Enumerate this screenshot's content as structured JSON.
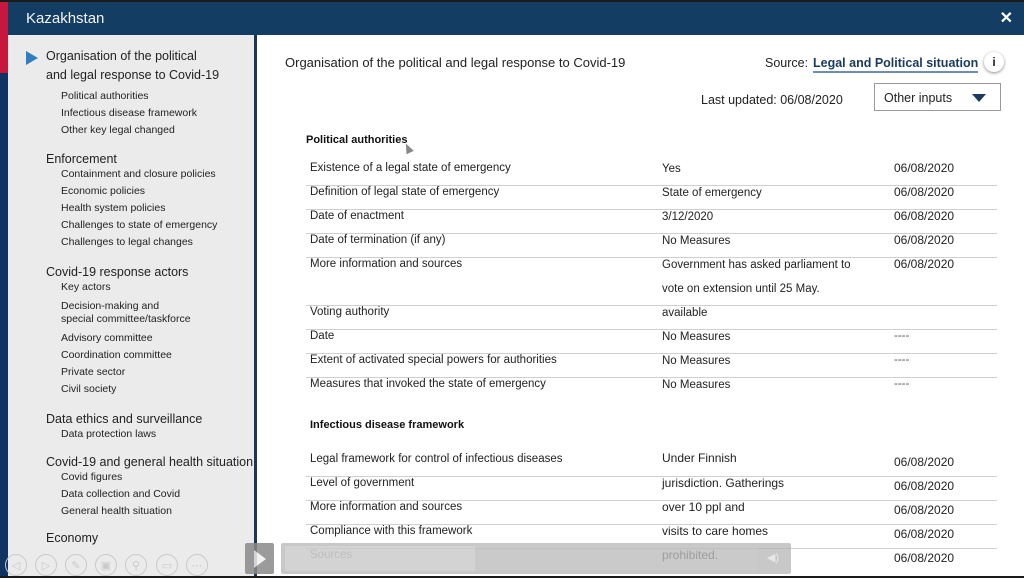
{
  "window": {
    "title": "Kazakhstan",
    "close_icon": "close-icon"
  },
  "sidebar": {
    "active_indicator_icon": "triangle-right-icon",
    "sections": [
      {
        "title_line1": "Organisation of the political",
        "title_line2": "and legal response to Covid-19",
        "items": [
          "Political authorities",
          "Infectious disease framework",
          "Other key legal changed"
        ]
      },
      {
        "title": "Enforcement",
        "items": [
          "Containment and closure policies",
          "Economic policies",
          "Health system policies",
          "Challenges to state of emergency",
          "Challenges to legal changes"
        ]
      },
      {
        "title": "Covid-19 response actors",
        "items": [
          "Key actors",
          "Decision-making and",
          "special committee/taskforce",
          "Advisory committee",
          "Coordination committee",
          "Private sector",
          "Civil society"
        ]
      },
      {
        "title": "Data ethics and surveillance",
        "items": [
          "Data protection laws"
        ]
      },
      {
        "title": "Covid-19 and general health situation",
        "items": [
          "Covid figures",
          "Data collection and Covid",
          "General health situation"
        ]
      },
      {
        "title": "Economy",
        "items": []
      }
    ]
  },
  "player_controls": {
    "icons": [
      "previous-icon",
      "next-icon",
      "pen-icon",
      "slides-icon",
      "zoom-icon",
      "subtitles-icon",
      "more-icon"
    ],
    "play_icon": "play-icon",
    "volume_icon": "volume-icon"
  },
  "main": {
    "title": "Organisation of the political and legal response to Covid-19",
    "source_label": "Source:",
    "source_link": "Legal and Political situation",
    "info_icon": "i",
    "last_updated": "Last updated: 06/08/2020",
    "dropdown": {
      "selected": "Other inputs"
    },
    "sections": [
      {
        "heading": "Political authorities",
        "rows": [
          {
            "field": "Existence of a legal state of emergency",
            "value": "Yes",
            "date": "06/08/2020"
          },
          {
            "field": "Definition of legal state of emergency",
            "value": "State of emergency",
            "date": "06/08/2020"
          },
          {
            "field": "Date of enactment",
            "value": "3/12/2020",
            "date": "06/08/2020"
          },
          {
            "field": "Date of termination (if any)",
            "value": "No Measures",
            "date": "06/08/2020"
          },
          {
            "field": "More information and sources",
            "value_line1": "Government has asked parliament to",
            "value_line2": "vote on extension until 25 May.",
            "date": "06/08/2020"
          },
          {
            "field": "Voting authority",
            "value": "available",
            "date": ""
          },
          {
            "field": "Date",
            "value": "No Measures",
            "date": "----"
          },
          {
            "field": "Extent of activated special powers for authorities",
            "value": "No Measures",
            "date": "----"
          },
          {
            "field": "Measures that invoked the state of emergency",
            "value": "No Measures",
            "date": "----"
          }
        ]
      },
      {
        "heading": "Infectious disease framework",
        "rows": [
          {
            "field": "Legal framework for control of infectious diseases",
            "value": "Under Finnish",
            "date": "06/08/2020"
          },
          {
            "field": "Level of government",
            "value": "jurisdiction. Gatherings",
            "date": "06/08/2020"
          },
          {
            "field": "More information and sources",
            "value": "over 10 ppl and",
            "date": "06/08/2020"
          },
          {
            "field": "Compliance with this framework",
            "value": "visits to care homes",
            "date": "06/08/2020"
          },
          {
            "field": "Sources",
            "value": "prohibited.",
            "date": "06/08/2020"
          }
        ]
      }
    ]
  }
}
